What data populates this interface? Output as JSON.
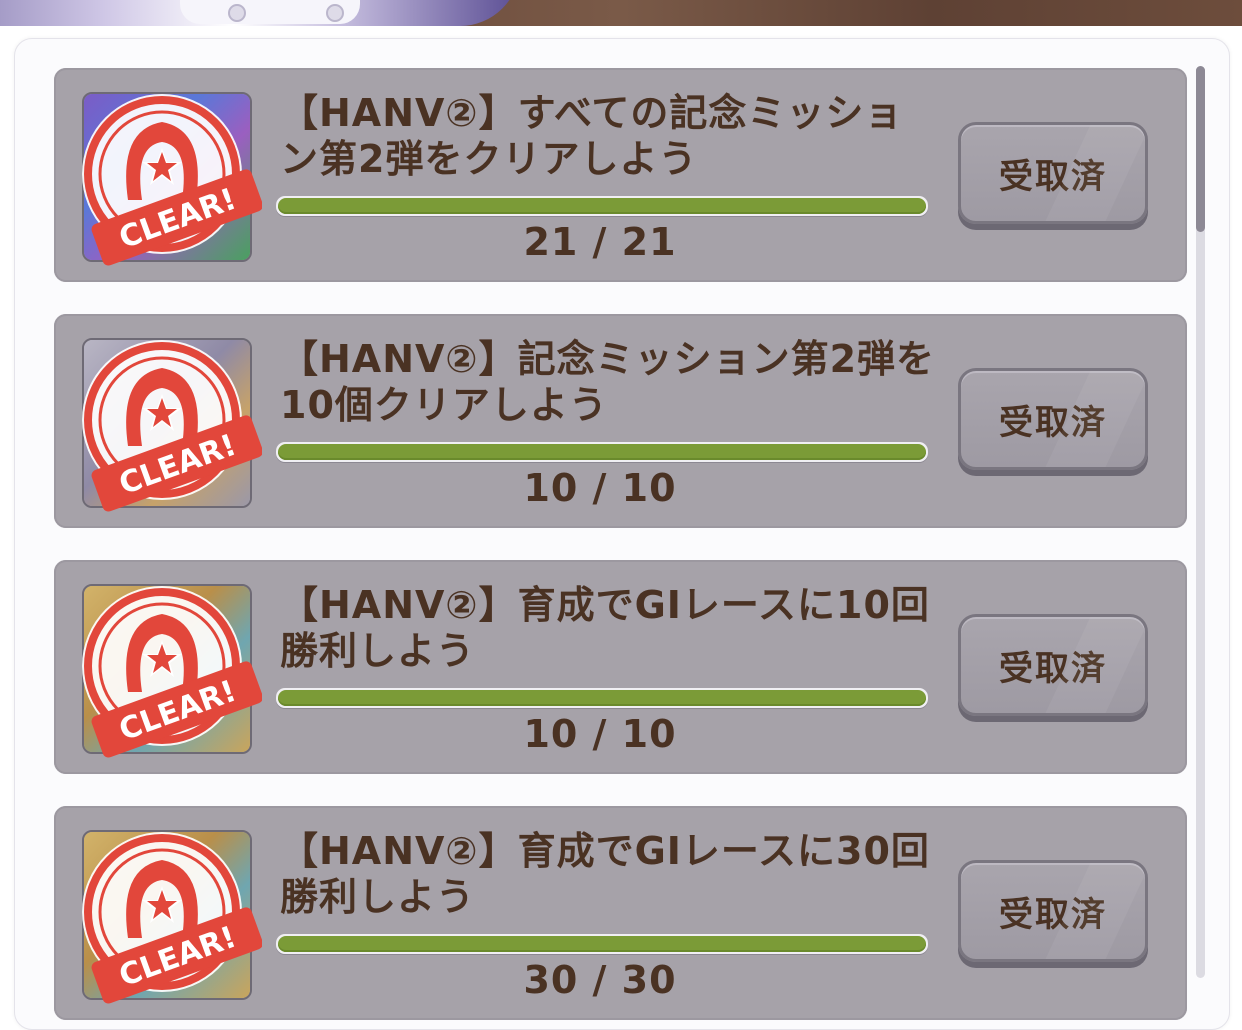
{
  "colors": {
    "card_bg": "#a6a2a9",
    "text": "#4a3223",
    "progress_fill": "#7b9b37",
    "stamp_red": "#e2473b"
  },
  "missions": [
    {
      "title": "【HANV②】すべての記念ミッション第2弾をクリアしよう",
      "progress_text": "21 / 21",
      "progress": 1.0,
      "status_label": "CLEAR!",
      "button_label": "受取済",
      "thumb_icon": "support-card-icon"
    },
    {
      "title": "【HANV②】記念ミッション第2弾を10個クリアしよう",
      "progress_text": "10 / 10",
      "progress": 1.0,
      "status_label": "CLEAR!",
      "button_label": "受取済",
      "thumb_icon": "item-icon"
    },
    {
      "title": "【HANV②】育成でGⅠレースに10回勝利しよう",
      "progress_text": "10 / 10",
      "progress": 1.0,
      "status_label": "CLEAR!",
      "button_label": "受取済",
      "thumb_icon": "ticket-icon"
    },
    {
      "title": "【HANV②】育成でGⅠレースに30回勝利しよう",
      "progress_text": "30 / 30",
      "progress": 1.0,
      "status_label": "CLEAR!",
      "button_label": "受取済",
      "thumb_icon": "ticket-icon"
    }
  ]
}
